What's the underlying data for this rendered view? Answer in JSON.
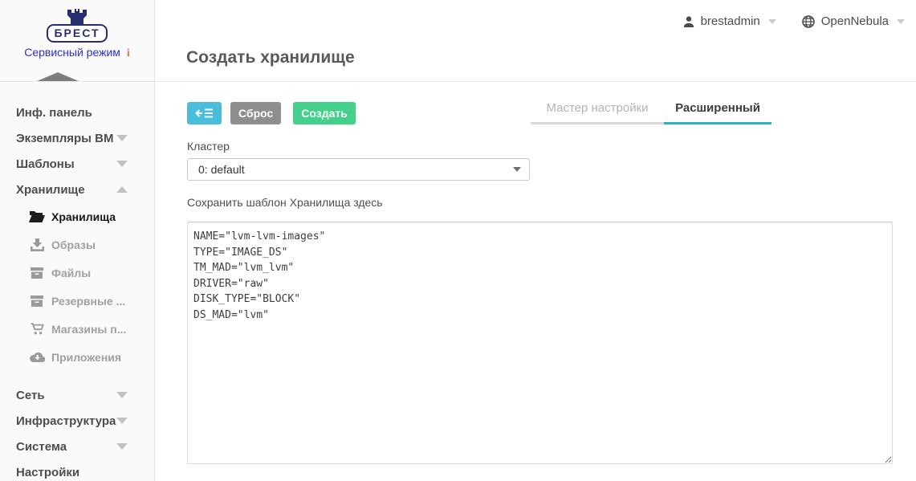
{
  "brand": {
    "logo_text": "БРЕСТ",
    "service_mode_label": "Сервисный режим",
    "info_badge": "i",
    "logo_color": "#272e6d",
    "service_link_color": "#2d2fd0",
    "info_badge_color": "#e4745f"
  },
  "topbar": {
    "user_label": "brestadmin",
    "user_icon": "person-icon",
    "zone_label": "OpenNebula",
    "zone_icon": "globe-icon"
  },
  "page": {
    "title": "Создать хранилище"
  },
  "toolbar": {
    "back_button_icon": "arrow-left-list-icon",
    "back_button_color": "#4abddb",
    "reset_label": "Сброс",
    "reset_color": "#8e8e8e",
    "create_label": "Создать",
    "create_color": "#42d08b"
  },
  "tabs": {
    "wizard_label": "Мастер настройки",
    "advanced_label": "Расширенный",
    "active_tab": "Расширенный",
    "active_underline_color": "#2eb2c5"
  },
  "form": {
    "cluster_label": "Кластер",
    "cluster_value": "0: default",
    "template_label": "Сохранить шаблон Хранилища здесь",
    "template_value": "NAME=\"lvm-lvm-images\"\nTYPE=\"IMAGE_DS\"\nTM_MAD=\"lvm_lvm\"\nDRIVER=\"raw\"\nDISK_TYPE=\"BLOCK\"\nDS_MAD=\"lvm\""
  },
  "sidebar": {
    "items": [
      {
        "label": "Инф. панель"
      },
      {
        "label": "Экземпляры ВМ",
        "chevron": "down"
      },
      {
        "label": "Шаблоны",
        "chevron": "down"
      },
      {
        "label": "Хранилище",
        "chevron": "up",
        "expanded": true
      },
      {
        "label": "Хранилища",
        "icon": "folder-open-icon",
        "active": true
      },
      {
        "label": "Образы",
        "icon": "download-icon"
      },
      {
        "label": "Файлы",
        "icon": "archive-icon"
      },
      {
        "label": "Резервные ...",
        "icon": "archive-box-icon"
      },
      {
        "label": "Магазины п...",
        "icon": "cart-icon"
      },
      {
        "label": "Приложения",
        "icon": "cloud-download-icon"
      },
      {
        "label": "Сеть",
        "chevron": "down"
      },
      {
        "label": "Инфраструктура",
        "chevron": "down"
      },
      {
        "label": "Система",
        "chevron": "down"
      },
      {
        "label": "Настройки"
      }
    ]
  }
}
